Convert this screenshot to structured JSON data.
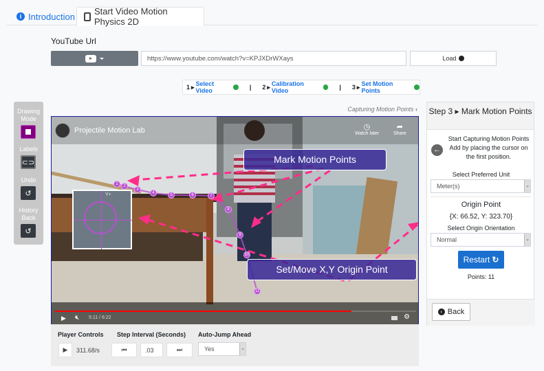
{
  "tabs": [
    {
      "label": "Introduction",
      "icon": "info-icon"
    },
    {
      "label": "Start Video Motion Physics 2D",
      "icon": "tablet-icon"
    }
  ],
  "url_section": {
    "label": "YouTube Url",
    "url_value": "https://www.youtube.com/watch?v=KPJXDrWXays",
    "load_label": "Load"
  },
  "steps": [
    {
      "num": "1",
      "label": "Select Video"
    },
    {
      "num": "2",
      "label": "Calibration Video"
    },
    {
      "num": "3",
      "label": "Set Motion Points"
    }
  ],
  "steps_separator": "|",
  "capturing_label": "Capturing Motion Points",
  "toolbar": {
    "drawing_mode": "Drawing Mode",
    "labels": "Labels",
    "undo": "Undo",
    "history_back": "History Back"
  },
  "video": {
    "title": "Projectile Motion Lab",
    "watch_later": "Watch later",
    "share": "Share",
    "time": "5:11 / 6:22",
    "progress_percent": 82,
    "banner_mark": "Mark Motion Points",
    "banner_origin": "Set/Move X,Y Origin Point",
    "inset_label": "Y+",
    "points": [
      "1",
      "2",
      "3",
      "4",
      "5",
      "6",
      "7",
      "8",
      "9",
      "10",
      "11"
    ]
  },
  "player": {
    "controls_label": "Player Controls",
    "rate": "311.68/s",
    "step_label": "Step Interval (Seconds)",
    "step_value": ".03",
    "auto_label": "Auto-Jump Ahead",
    "auto_value": "Yes"
  },
  "panel": {
    "header": "Step 3 ▸ Mark Motion Points",
    "instr1": "Start Capturing Motion Points",
    "instr2": "Add by placing the cursor on the first position.",
    "unit_label": "Select Preferred Unit",
    "unit_value": "Meter(s)",
    "origin_title": "Origin Point",
    "origin_value": "{X: 66.52, Y: 323.70}",
    "orientation_label": "Select Origin Orientation",
    "orientation_value": "Normal",
    "restart_label": "Restart",
    "points_count": "Points: 11",
    "back_label": "Back"
  },
  "colors": {
    "accent": "#1a73e8",
    "drawing_active": "#800080",
    "annotation_arrow": "#ff2d8a",
    "point": "#b84fd0"
  }
}
